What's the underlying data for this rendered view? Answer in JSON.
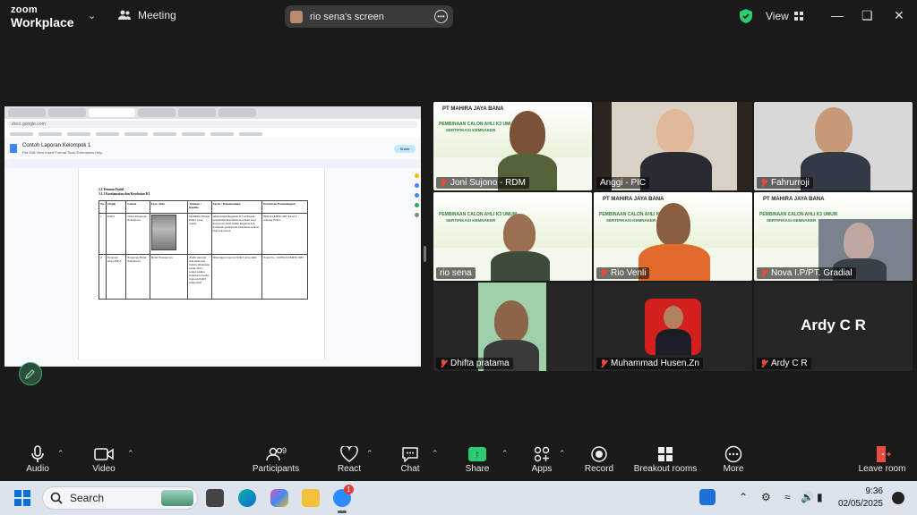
{
  "topbar": {
    "logo_line1": "zoom",
    "logo_line2": "Workplace",
    "meeting_label": "Meeting",
    "screen_share_label": "rio sena's screen",
    "view_label": "View"
  },
  "shared_screen": {
    "browser_tab": "Copy of Laporan...",
    "url": "docs.google.com",
    "doc_title": "Contoh Laporan Kelompok 1",
    "doc_menu": "File  Edit  View  Insert  Format  Tools  Extensions  Help",
    "share_label": "Share",
    "heading1": "3.1 Temuan Positif",
    "heading2": "3.1.1 Keselamatan dan Kesehatan K3",
    "table_headers": [
      "No.",
      "Objek",
      "Lokasi",
      "Foto / Info",
      "Temuan / Realita",
      "Saran / Rekomendasi",
      "Peraturan Perundangan"
    ],
    "rows": [
      {
        "no": "1",
        "objek": "P2K3",
        "lokasi": "Hotel Pangeran Pekanbaru",
        "temuan": "Memiliki Panitia P2K3 yang resmi.",
        "saran": "Aktif dalam kegiatan K3 termasuk penerbitan keselamatan terkait bagi karyawan aktif dalam kegiatan K3, termasuk penerbitan kesehatan terkait bagi karyawan",
        "peraturan": "PER.04/MEN/1987 Pasal 2 tentang P2K3."
      },
      {
        "no": "2",
        "objek": "Program kerja P2K3",
        "lokasi": "Pangeran Hotel Pekanbaru",
        "foto": "Hotel Wawancara",
        "temuan": "Audit internal dan eksternal belum dilakukan sejak 2015, tetapi auditor internal tersedia. laporan P2K3 tetap aktif",
        "saran": "Ditetapkan laporan P2K3 tetap aktif",
        "peraturan": "Pasal No. 10 PER.04/MEN/1987."
      }
    ]
  },
  "participants": [
    {
      "name": "Joni Sujono - RDM",
      "muted": true
    },
    {
      "name": "Anggi - PIC",
      "muted": false
    },
    {
      "name": "Fahrurroji",
      "muted": true
    },
    {
      "name": "rio sena",
      "muted": false
    },
    {
      "name": "Rio Venli",
      "muted": true
    },
    {
      "name": "Nova I.P/PT. Gradial",
      "muted": true
    },
    {
      "name": "Dhifta pratama",
      "muted": true
    },
    {
      "name": "Muhammad Husen.Zn",
      "muted": true
    },
    {
      "name": "Ardy C R",
      "muted": true
    }
  ],
  "tile_banner": {
    "company": "PT MAHIRA JAYA BANA",
    "line1": "PEMBINAAN CALON AHLI K3 UMUM",
    "line2": "SERTIFIKASI KEMNAKER"
  },
  "ardy_display_name": "Ardy C R",
  "toolbar": {
    "audio": "Audio",
    "video": "Video",
    "participants": "Participants",
    "participants_count": "9",
    "react": "React",
    "chat": "Chat",
    "share": "Share",
    "apps": "Apps",
    "record": "Record",
    "breakout": "Breakout rooms",
    "more": "More",
    "leave": "Leave room"
  },
  "taskbar": {
    "search_placeholder": "Search",
    "time": "9:36",
    "date": "02/05/2025",
    "zoom_badge": "1"
  },
  "colors": {
    "zoom_green": "#2ecc71",
    "active_speaker_outline": "#2ecc71",
    "muted_red": "#e74c3c"
  }
}
